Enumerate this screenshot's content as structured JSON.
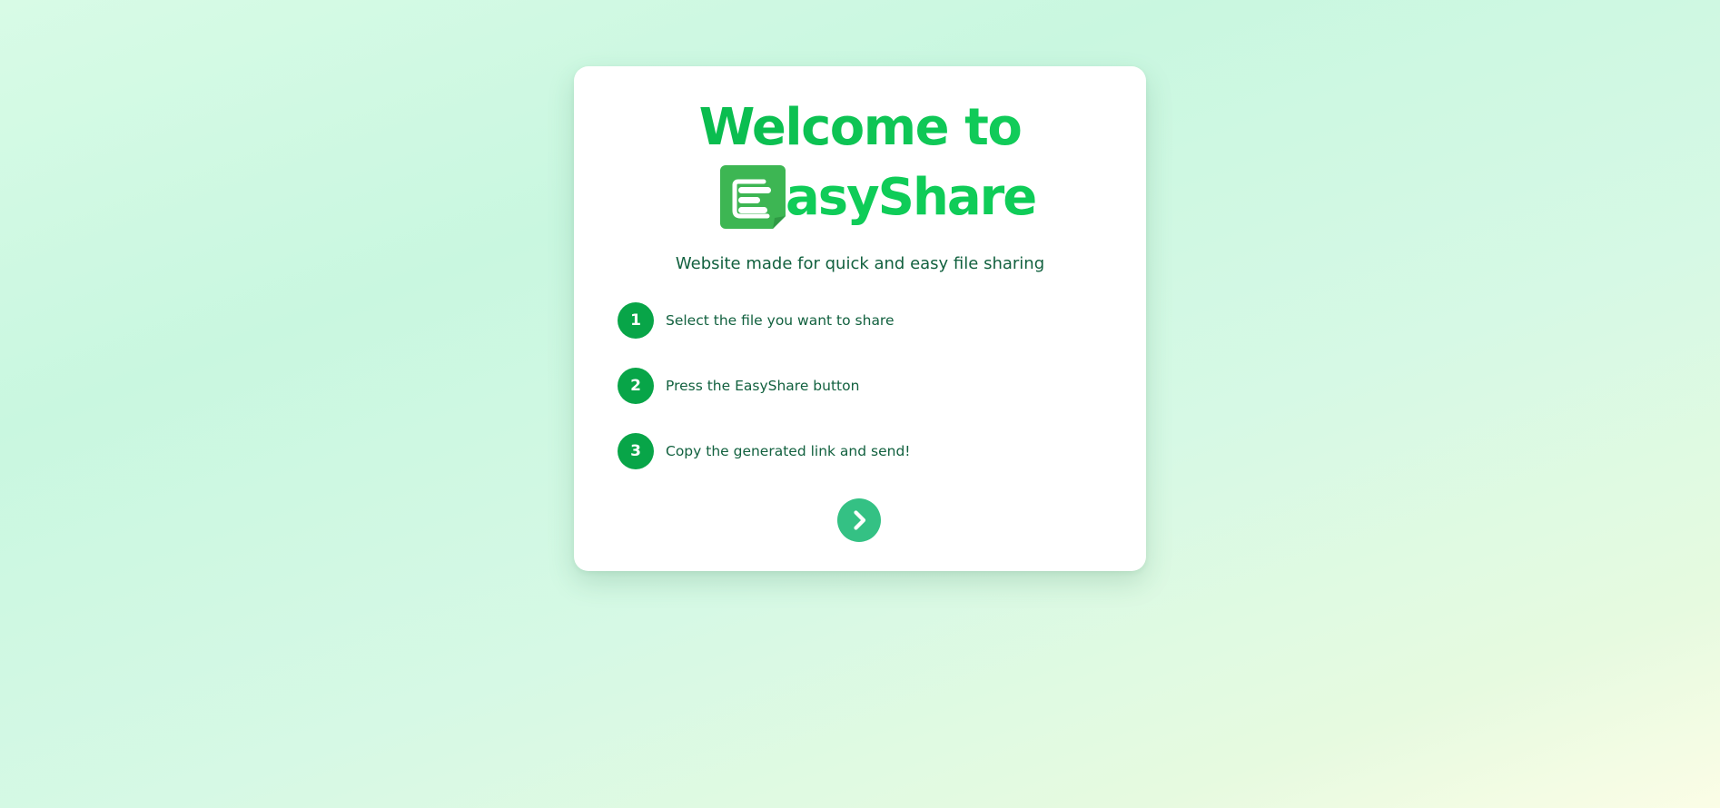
{
  "welcome": {
    "title": "Welcome to",
    "brand_name": "asyShare",
    "logo_icon": "easyshare-logo-icon",
    "tagline": "Website made for quick and easy file sharing"
  },
  "steps": [
    {
      "number": "1",
      "text": "Select the file you want to share"
    },
    {
      "number": "2",
      "text": "Press the EasyShare button"
    },
    {
      "number": "3",
      "text": "Copy the generated link and send!"
    }
  ],
  "next_button": {
    "icon": "chevron-right-icon"
  },
  "colors": {
    "brand_green": "#0fcc58",
    "step_badge": "#08a548",
    "text_dark_green": "#12613f",
    "next_button": "#34c184",
    "logo_green": "#3db653"
  }
}
